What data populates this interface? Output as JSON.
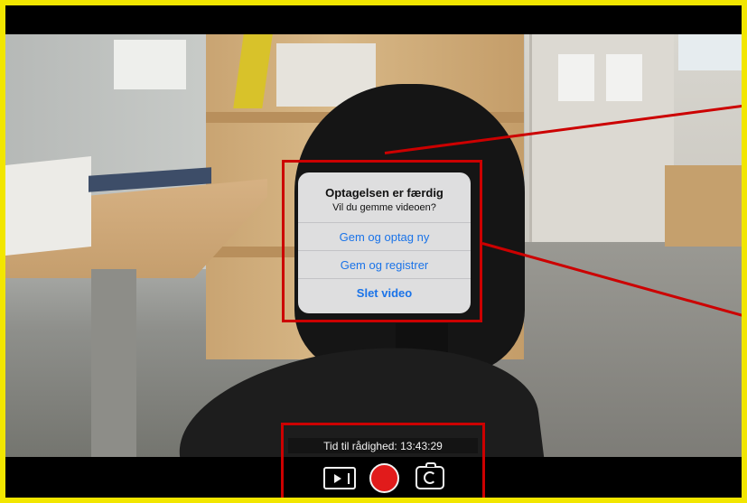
{
  "dialog": {
    "title": "Optagelsen er færdig",
    "message": "Vil du gemme videoen?",
    "buttons": [
      {
        "label": "Gem og optag ny"
      },
      {
        "label": "Gem og registrer"
      },
      {
        "label": "Slet video"
      }
    ]
  },
  "camera": {
    "time_available": "Tid til rådighed: 13:43:29"
  },
  "icons": {
    "play": "video-library-icon",
    "record": "record-icon",
    "switch_camera": "switch-camera-icon"
  },
  "colors": {
    "frame_border": "#f2e600",
    "annotation": "#cc0000",
    "dialog_button": "#1a73e8",
    "record": "#e11b1b"
  }
}
